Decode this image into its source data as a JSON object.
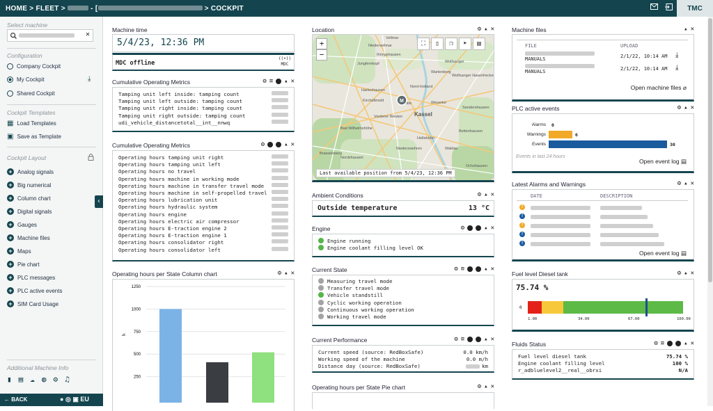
{
  "breadcrumb": {
    "home": "HOME",
    "fleet": "FLEET",
    "sep": ">",
    "dash": "-",
    "bracket": "[",
    "cockpit": "COCKPIT"
  },
  "topbar": {
    "user": "TMC"
  },
  "sidebar": {
    "select_label": "Select machine",
    "config_label": "Configuration",
    "config_items": [
      "Company Cockpit",
      "My Cockpit",
      "Shared Cockpit"
    ],
    "templates_label": "Cockpit Templates",
    "template_items": [
      "Load Templates",
      "Save as Template"
    ],
    "layout_label": "Cockpit Layout",
    "layout_items": [
      "Analog signals",
      "Big numerical",
      "Column chart",
      "Digital signals",
      "Gauges",
      "Machine files",
      "Maps",
      "Pie chart",
      "PLC messages",
      "PLC active events",
      "SIM Card Usage"
    ],
    "additional_label": "Additional Machine Info",
    "back": "BACK",
    "lang": "EU"
  },
  "machine_time": {
    "title": "Machine time",
    "value": "5/4/23, 12:36 PM",
    "status": "MDC offline",
    "badge": "MDC"
  },
  "cum1": {
    "title": "Cumulative Operating Metrics",
    "rows": [
      "Tamping unit left inside: tamping count",
      "Tamping unit left outside: tamping count",
      "Tamping unit right inside: tamping count",
      "Tamping unit right outside: tamping count",
      "udi_vehicle_distancetotal__int__nnwq"
    ]
  },
  "cum2": {
    "title": "Cumulative Operating Metrics",
    "rows": [
      "Operating hours tamping unit right",
      "Operating hours tamping unit left",
      "Operating hours no travel",
      "Operating hours machine in working mode",
      "Operating hours machine in transfer travel mode",
      "Operating hours machine in self-propelled travel",
      "Operating hours lubrication unit",
      "Operating hours hydraulic system",
      "Operating hours engine",
      "Operating hours electric air compressor",
      "Operating hours E-traction engine 2",
      "Operating hours E-traction engine 1",
      "Operating hours consolidator right",
      "Operating hours consolidator left"
    ]
  },
  "column_chart": {
    "title": "Operating hours per State Column chart"
  },
  "chart_data": {
    "type": "bar",
    "categories": [
      "",
      "",
      ""
    ],
    "values": [
      1000,
      410,
      520
    ],
    "colors": [
      "#7bb3e6",
      "#3a3d42",
      "#8fe07f"
    ],
    "ylim": [
      0,
      1250
    ],
    "ticks": [
      250,
      500,
      750,
      1000,
      1250
    ],
    "xlabel": "",
    "ylabel": "h"
  },
  "location": {
    "title": "Location",
    "caption": "Last available position from 5/4/23, 12:36 PM",
    "places": [
      "Vellmar",
      "Niedervellmar",
      "Ihringshausen",
      "Jungfernkopf",
      "Wolfsanger",
      "Harleshausen",
      "Nord-Holland",
      "Wolfsanger Hasenhecke",
      "Wartenberg",
      "Kirchditmold",
      "Mitte",
      "Wesertor",
      "Sandershausen",
      "Vorderer Westen",
      "Kassel",
      "Bad Wilhelmshöhe",
      "Bettenhausen",
      "Helleböhn",
      "Niederzwehren",
      "Waldau",
      "Brasselsberg",
      "Nordshausen",
      "Ochshausen"
    ]
  },
  "ambient": {
    "title": "Ambient Conditions",
    "label": "Outside temperature",
    "value": "13 °C"
  },
  "engine": {
    "title": "Engine",
    "items": [
      "Engine running",
      "Engine coolant filling level OK"
    ]
  },
  "current_state": {
    "title": "Current State",
    "items": [
      [
        "Measuring travel mode",
        "gr"
      ],
      [
        "Transfer travel mode",
        "gr"
      ],
      [
        "Vehicle standstill",
        "g"
      ],
      [
        "Cyclic working operation",
        "gr"
      ],
      [
        "Continuous working operation",
        "gr"
      ],
      [
        "Working travel mode",
        "gr"
      ]
    ]
  },
  "performance": {
    "title": "Current Performance",
    "rows": [
      [
        "Current speed (source: RedBoxSafe)",
        "0.0 km/h"
      ],
      [
        "Working speed of the machine",
        "0.0 m/h"
      ],
      [
        "Distance day (source: RedBoxSafe)",
        "km"
      ]
    ]
  },
  "pie": {
    "title": "Operating hours per State Pie chart"
  },
  "files": {
    "title": "Machine files",
    "col_file": "FILE",
    "col_upload": "UPLOAD",
    "rows": [
      [
        "MANUALS",
        "2/1/22, 10:14 AM"
      ],
      [
        "MANUALS",
        "2/1/22, 10:14 AM"
      ]
    ],
    "open": "Open machine files"
  },
  "plc": {
    "title": "PLC active events",
    "rows": [
      [
        "Alarms",
        "0"
      ],
      [
        "Warnings",
        "6"
      ],
      [
        "Events",
        "30"
      ]
    ],
    "note": "Events in last 24 hours",
    "open": "Open event log"
  },
  "alarms": {
    "title": "Latest Alarms and Warnings",
    "col_date": "DATE",
    "col_desc": "DESCRIPTION",
    "open": "Open event log"
  },
  "fuel": {
    "title": "Fuel level Diesel tank",
    "value": "75.74 %",
    "level": 75.74,
    "ticks": [
      "1.00",
      "34.00",
      "67.00",
      "100.00"
    ],
    "zero": "0"
  },
  "fluids": {
    "title": "Fluids Status",
    "rows": [
      [
        "Fuel level diesel tank",
        "75.74 %"
      ],
      [
        "Engine coolant filling level",
        "100 %"
      ],
      [
        "r_adbluelevel2__real__obrxi",
        "N/A"
      ]
    ]
  }
}
